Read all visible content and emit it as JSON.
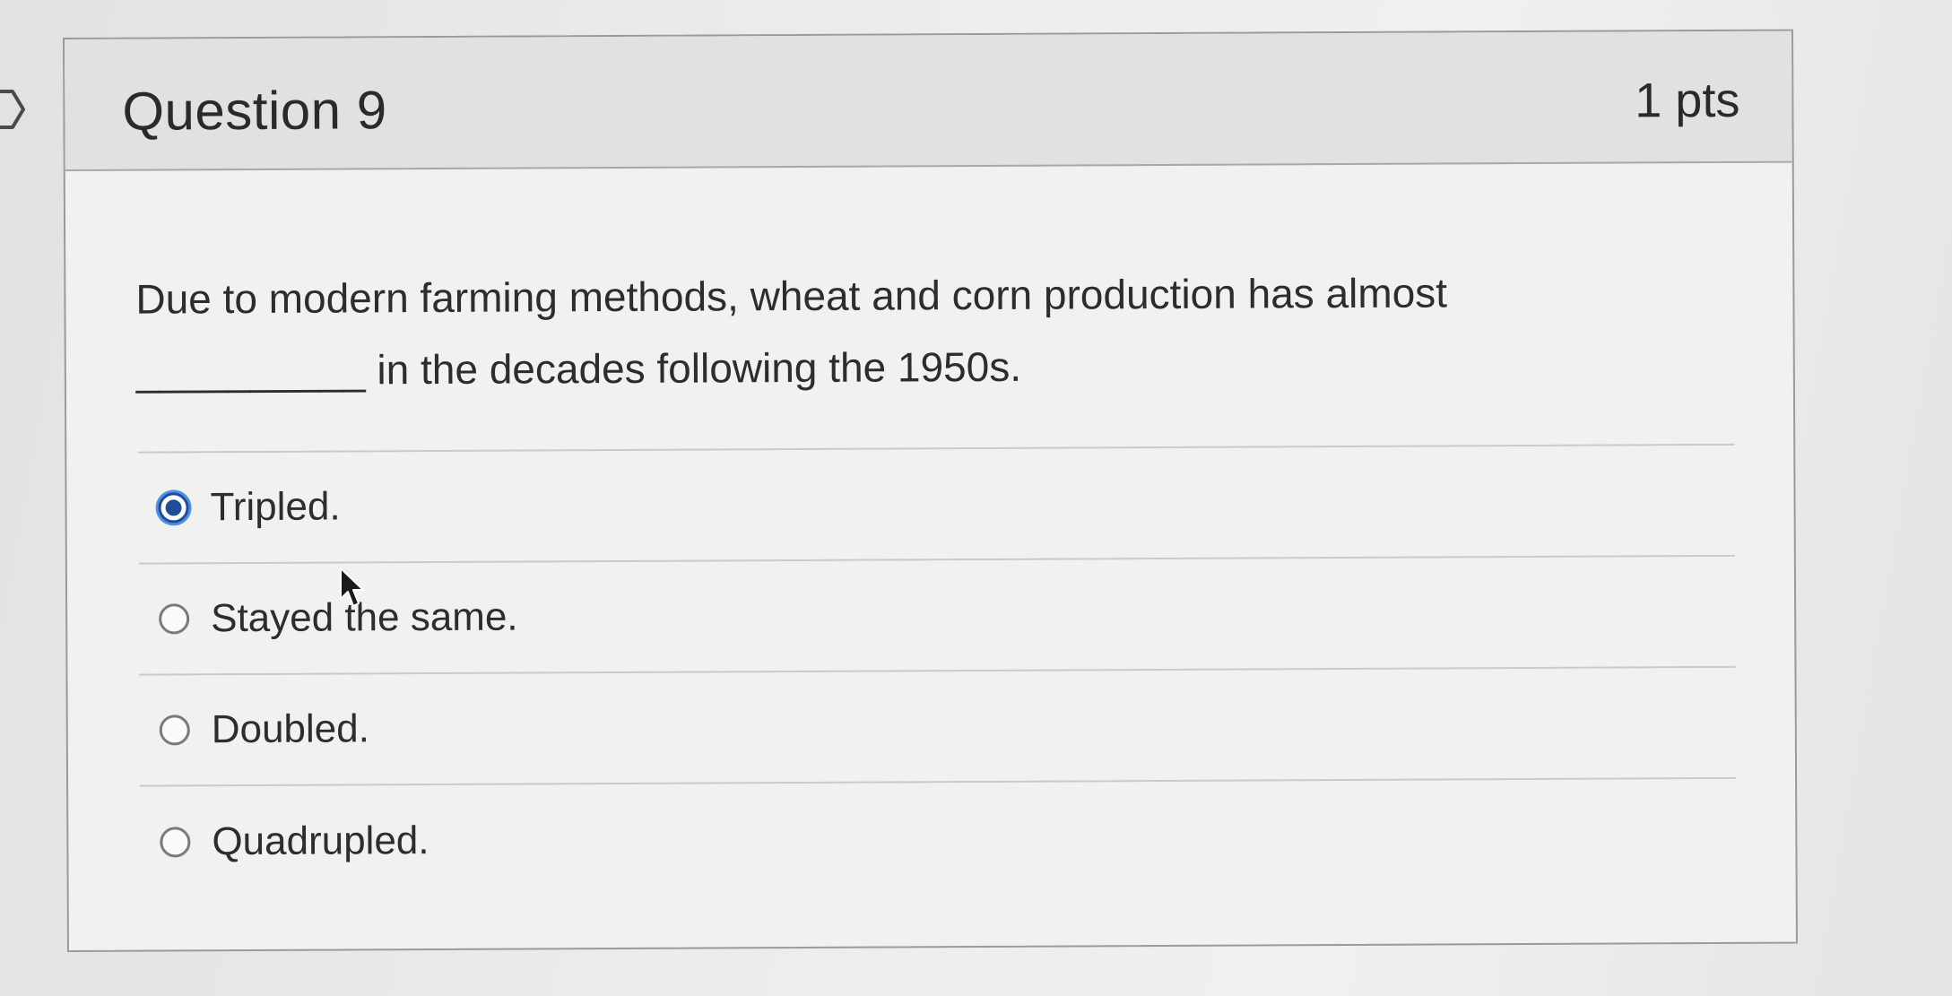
{
  "question": {
    "title": "Question 9",
    "points": "1 pts",
    "text_part1": "Due to modern farming methods, wheat and corn production has almost",
    "blank": "__________",
    "text_part2": " in the decades following the 1950s.",
    "answers": [
      {
        "label": "Tripled.",
        "selected": true
      },
      {
        "label": "Stayed the same.",
        "selected": false
      },
      {
        "label": "Doubled.",
        "selected": false
      },
      {
        "label": "Quadrupled.",
        "selected": false
      }
    ]
  },
  "colors": {
    "page_background": "#e6e6e4",
    "card_background": "#f1f1ef",
    "header_background": "#e1e1df",
    "selected_radio": "#1f4d98",
    "selected_ring": "#4f8fe6"
  },
  "icons": {
    "left_marker": "chevron-right-outline-icon",
    "cursor": "mouse-pointer-icon"
  }
}
